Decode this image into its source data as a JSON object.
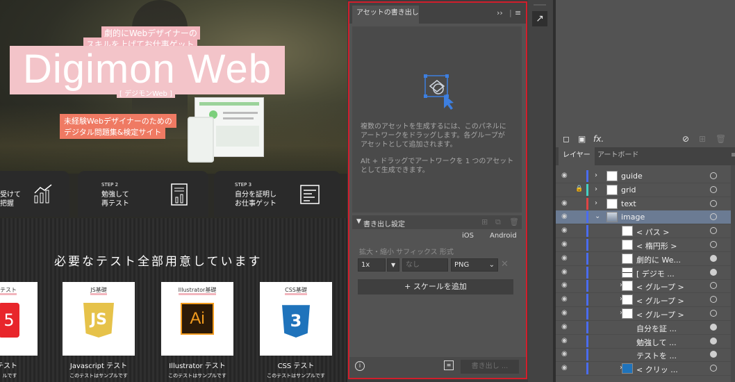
{
  "artboard": {
    "hero_sub_1": "劇的にWebデザイナーの",
    "hero_sub_2": "スキルを上げてお仕事ゲット",
    "title": "Digimon Web",
    "title_kana": "[ デジモンWeb ]",
    "desc_1": "未経験Webデザイナーのための",
    "desc_2": "デジタル問題集&検定サイト",
    "steps": [
      {
        "label": "",
        "text": "受けて\n把握"
      },
      {
        "label": "STEP 2",
        "text": "勉強して\n再テスト"
      },
      {
        "label": "STEP 3",
        "text": "自分を証明し\nお仕事ゲット"
      }
    ],
    "section_heading": "必要なテスト全部用意しています",
    "cards": [
      {
        "label": "テスト",
        "name": "テスト",
        "note": "ルです",
        "color": "#e8262b"
      },
      {
        "label": "JS基礎",
        "name": "Javascript テスト",
        "note": "このテストはサンプルです",
        "color": "#e6c24a"
      },
      {
        "label": "Illustrator基礎",
        "name": "Illustrator テスト",
        "note": "このテストはサンプルです",
        "color": "#2c1a08"
      },
      {
        "label": "CSS基礎",
        "name": "CSS テスト",
        "note": "このテストはサンプルです",
        "color": "#1f73bb"
      }
    ],
    "card_logo_text": [
      "5",
      "JS",
      "Ai",
      "3"
    ]
  },
  "asset_panel": {
    "tab": "アセットの書き出し",
    "menu_glyph": "≡",
    "collapse_glyph": "››",
    "drop_text_1": "複数のアセットを生成するには、このパネルに\nアートワークをドラッグします。各グループが\nアセットとして追加されます。",
    "drop_text_2": "Alt + ドラッグでアートワークを 1 つのアセット\nとして生成できます。",
    "export_settings": "書き出し設定",
    "ios": "iOS",
    "android": "Android",
    "row_header": "拡大・縮小  サフィックス  形式",
    "scale": "1x",
    "suffix_placeholder": "なし",
    "format": "PNG",
    "add_scale": "+ スケールを追加",
    "export_button": "書き出し ..."
  },
  "layers_panel": {
    "tab_layers": "レイヤー",
    "tab_artboards": "アートボード",
    "fx_label": "fx.",
    "layers": [
      {
        "name": "guide",
        "level": 0,
        "twirl": "›",
        "color": "#4a6cf0",
        "locked": false,
        "selected": false,
        "thumb": "blank",
        "target_fill": false
      },
      {
        "name": "grid",
        "level": 0,
        "twirl": "›",
        "color": "#45d1c5",
        "locked": true,
        "selected": false,
        "thumb": "blank",
        "target_fill": false
      },
      {
        "name": "text",
        "level": 0,
        "twirl": "›",
        "color": "#e04444",
        "locked": false,
        "selected": false,
        "thumb": "text",
        "target_fill": false
      },
      {
        "name": "image",
        "level": 0,
        "twirl": "⌄",
        "color": "#4a6cf0",
        "locked": false,
        "selected": true,
        "thumb": "img",
        "target_fill": false
      },
      {
        "name": "< パス >",
        "level": 1,
        "twirl": "",
        "color": "#4a6cf0",
        "locked": false,
        "selected": false,
        "thumb": "blank",
        "target_fill": false
      },
      {
        "name": "< 楕円形 >",
        "level": 1,
        "twirl": "",
        "color": "#4a6cf0",
        "locked": false,
        "selected": false,
        "thumb": "blank",
        "target_fill": false
      },
      {
        "name": "劇的に We...",
        "level": 1,
        "twirl": "",
        "color": "#4a6cf0",
        "locked": false,
        "selected": false,
        "thumb": "blank",
        "target_fill": true
      },
      {
        "name": "[ デジモ ...",
        "level": 1,
        "twirl": "",
        "color": "#4a6cf0",
        "locked": false,
        "selected": false,
        "thumb": "line",
        "target_fill": true
      },
      {
        "name": "< グループ >",
        "level": 1,
        "twirl": "›",
        "color": "#4a6cf0",
        "locked": false,
        "selected": false,
        "thumb": "blank",
        "target_fill": false
      },
      {
        "name": "< グループ >",
        "level": 1,
        "twirl": "›",
        "color": "#4a6cf0",
        "locked": false,
        "selected": false,
        "thumb": "blank",
        "target_fill": false
      },
      {
        "name": "< グループ >",
        "level": 1,
        "twirl": "›",
        "color": "#4a6cf0",
        "locked": false,
        "selected": false,
        "thumb": "blank",
        "target_fill": false
      },
      {
        "name": "自分を証 ...",
        "level": 1,
        "twirl": "",
        "color": "#4a6cf0",
        "locked": false,
        "selected": false,
        "thumb": "none",
        "target_fill": true
      },
      {
        "name": "勉強して ...",
        "level": 1,
        "twirl": "",
        "color": "#4a6cf0",
        "locked": false,
        "selected": false,
        "thumb": "none",
        "target_fill": true
      },
      {
        "name": "テストを ...",
        "level": 1,
        "twirl": "",
        "color": "#4a6cf0",
        "locked": false,
        "selected": false,
        "thumb": "none",
        "target_fill": true
      },
      {
        "name": "< クリッ ...",
        "level": 1,
        "twirl": "›",
        "color": "#4a6cf0",
        "locked": false,
        "selected": false,
        "thumb": "css",
        "target_fill": false
      }
    ]
  }
}
